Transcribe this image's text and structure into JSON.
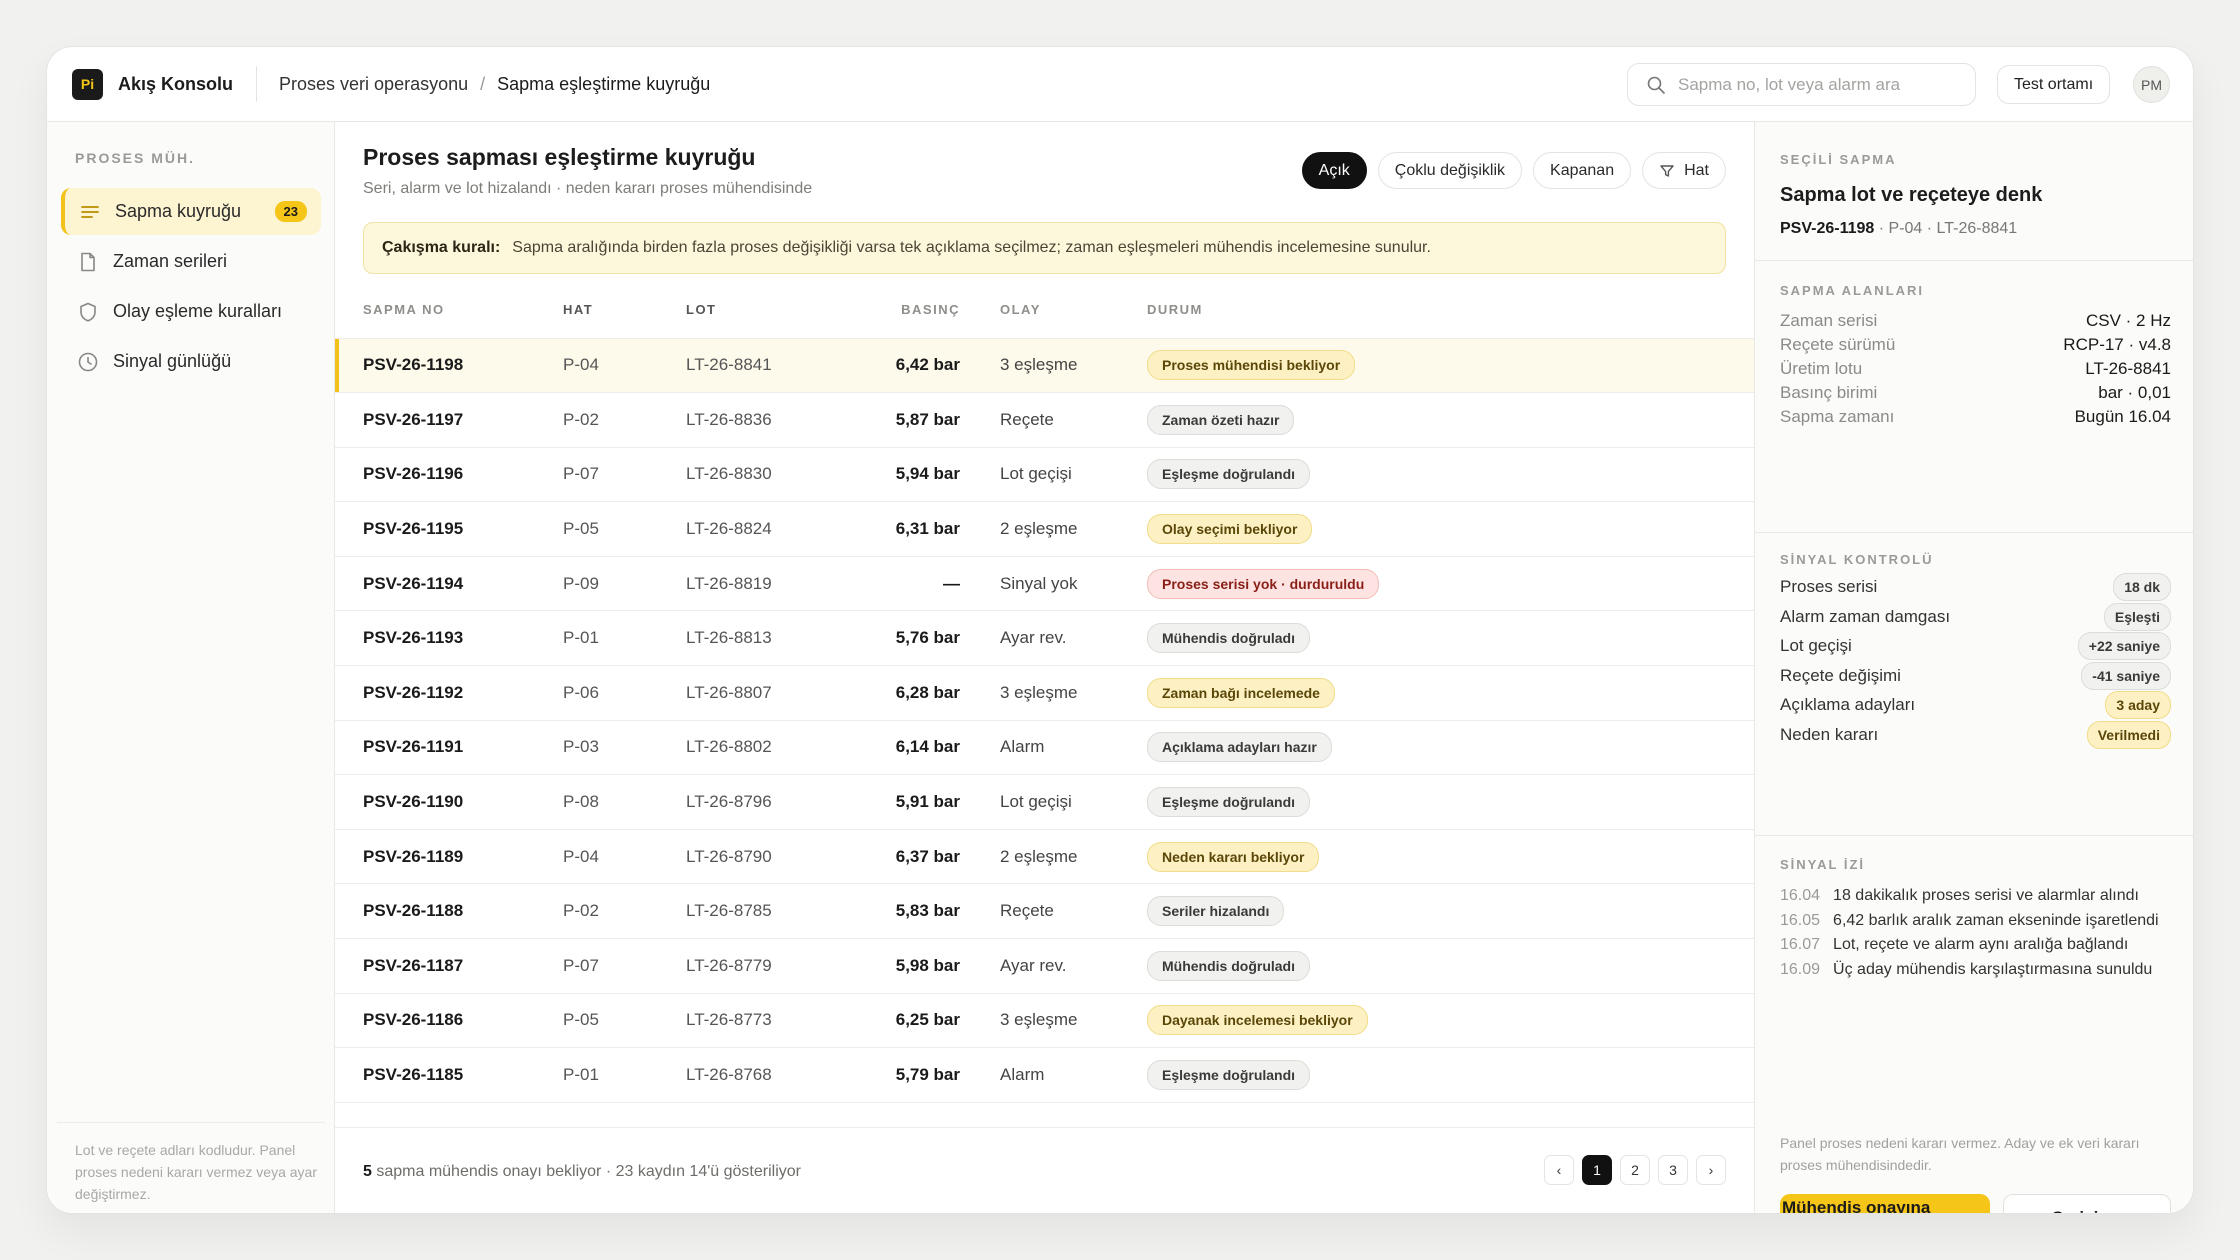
{
  "app": {
    "logo_text": "Pi",
    "name": "Akış Konsolu"
  },
  "breadcrumb": {
    "parent": "Proses veri operasyonu",
    "separator": "/",
    "current": "Sapma eşleştirme kuyruğu"
  },
  "search": {
    "placeholder": "Sapma no, lot veya alarm ara",
    "icon": "search-icon"
  },
  "env_button": "Test ortamı",
  "avatar": "PM",
  "sidebar": {
    "section": "PROSES MÜH.",
    "items": [
      {
        "label": "Sapma kuyruğu",
        "badge": "23",
        "icon": "list-icon",
        "active": true
      },
      {
        "label": "Zaman serileri",
        "icon": "document-icon"
      },
      {
        "label": "Olay eşleme kuralları",
        "icon": "shield-icon"
      },
      {
        "label": "Sinyal günlüğü",
        "icon": "clock-icon"
      }
    ],
    "footer": "Lot ve reçete adları kodludur. Panel proses nedeni kararı vermez veya ayar değiştirmez."
  },
  "main": {
    "title": "Proses sapması eşleştirme kuyruğu",
    "subtitle": "Seri, alarm ve lot hizalandı · neden kararı proses mühendisinde",
    "filters": [
      "Açık",
      "Çoklu değişiklik",
      "Kapanan",
      "Hat"
    ],
    "rule": {
      "label": "Çakışma kuralı:",
      "text": "Sapma aralığında birden fazla proses değişikliği varsa tek açıklama seçilmez; zaman eşleşmeleri mühendis incelemesine sunulur."
    },
    "columns": [
      "SAPMA NO",
      "HAT",
      "LOT",
      "BASINÇ",
      "OLAY",
      "DURUM"
    ],
    "rows": [
      {
        "no": "PSV-26-1198",
        "hat": "P-04",
        "lot": "LT-26-8841",
        "basinc": "6,42 bar",
        "olay": "3 eşleşme",
        "durum": "Proses mühendisi bekliyor",
        "tone": "yellow"
      },
      {
        "no": "PSV-26-1197",
        "hat": "P-02",
        "lot": "LT-26-8836",
        "basinc": "5,87 bar",
        "olay": "Reçete",
        "durum": "Zaman özeti hazır",
        "tone": "gray"
      },
      {
        "no": "PSV-26-1196",
        "hat": "P-07",
        "lot": "LT-26-8830",
        "basinc": "5,94 bar",
        "olay": "Lot geçişi",
        "durum": "Eşleşme doğrulandı",
        "tone": "gray"
      },
      {
        "no": "PSV-26-1195",
        "hat": "P-05",
        "lot": "LT-26-8824",
        "basinc": "6,31 bar",
        "olay": "2 eşleşme",
        "durum": "Olay seçimi bekliyor",
        "tone": "yellow"
      },
      {
        "no": "PSV-26-1194",
        "hat": "P-09",
        "lot": "LT-26-8819",
        "basinc": "—",
        "olay": "Sinyal yok",
        "durum": "Proses serisi yok · durduruldu",
        "tone": "red"
      },
      {
        "no": "PSV-26-1193",
        "hat": "P-01",
        "lot": "LT-26-8813",
        "basinc": "5,76 bar",
        "olay": "Ayar rev.",
        "durum": "Mühendis doğruladı",
        "tone": "gray"
      },
      {
        "no": "PSV-26-1192",
        "hat": "P-06",
        "lot": "LT-26-8807",
        "basinc": "6,28 bar",
        "olay": "3 eşleşme",
        "durum": "Zaman bağı incelemede",
        "tone": "yellow"
      },
      {
        "no": "PSV-26-1191",
        "hat": "P-03",
        "lot": "LT-26-8802",
        "basinc": "6,14 bar",
        "olay": "Alarm",
        "durum": "Açıklama adayları hazır",
        "tone": "gray"
      },
      {
        "no": "PSV-26-1190",
        "hat": "P-08",
        "lot": "LT-26-8796",
        "basinc": "5,91 bar",
        "olay": "Lot geçişi",
        "durum": "Eşleşme doğrulandı",
        "tone": "gray"
      },
      {
        "no": "PSV-26-1189",
        "hat": "P-04",
        "lot": "LT-26-8790",
        "basinc": "6,37 bar",
        "olay": "2 eşleşme",
        "durum": "Neden kararı bekliyor",
        "tone": "yellow"
      },
      {
        "no": "PSV-26-1188",
        "hat": "P-02",
        "lot": "LT-26-8785",
        "basinc": "5,83 bar",
        "olay": "Reçete",
        "durum": "Seriler hizalandı",
        "tone": "gray"
      },
      {
        "no": "PSV-26-1187",
        "hat": "P-07",
        "lot": "LT-26-8779",
        "basinc": "5,98 bar",
        "olay": "Ayar rev.",
        "durum": "Mühendis doğruladı",
        "tone": "gray"
      },
      {
        "no": "PSV-26-1186",
        "hat": "P-05",
        "lot": "LT-26-8773",
        "basinc": "6,25 bar",
        "olay": "3 eşleşme",
        "durum": "Dayanak incelemesi bekliyor",
        "tone": "yellow"
      },
      {
        "no": "PSV-26-1185",
        "hat": "P-01",
        "lot": "LT-26-8768",
        "basinc": "5,79 bar",
        "olay": "Alarm",
        "durum": "Eşleşme doğrulandı",
        "tone": "gray"
      }
    ],
    "footer": {
      "count": "5",
      "text": "sapma mühendis onayı bekliyor · 23 kaydın 14'ü gösteriliyor"
    },
    "pager": {
      "prev": "‹",
      "pages": [
        "1",
        "2",
        "3"
      ],
      "next": "›",
      "current": "1"
    }
  },
  "panel": {
    "section": "SEÇİLİ SAPMA",
    "title": "Sapma lot ve reçeteye denk",
    "id": "PSV-26-1198",
    "meta": "· P-04 · LT-26-8841",
    "fields_label": "SAPMA ALANLARI",
    "fields": [
      {
        "k": "Zaman serisi",
        "v": "CSV · 2 Hz"
      },
      {
        "k": "Reçete sürümü",
        "v": "RCP-17 · v4.8"
      },
      {
        "k": "Üretim lotu",
        "v": "LT-26-8841"
      },
      {
        "k": "Basınç birimi",
        "v": "bar · 0,01"
      },
      {
        "k": "Sapma zamanı",
        "v": "Bugün 16.04"
      }
    ],
    "checks_label": "SİNYAL KONTROLÜ",
    "checks": [
      {
        "k": "Proses serisi",
        "v": "18 dk",
        "tone": "gray"
      },
      {
        "k": "Alarm zaman damgası",
        "v": "Eşleşti",
        "tone": "gray"
      },
      {
        "k": "Lot geçişi",
        "v": "+22 saniye",
        "tone": "gray"
      },
      {
        "k": "Reçete değişimi",
        "v": "-41 saniye",
        "tone": "gray"
      },
      {
        "k": "Açıklama adayları",
        "v": "3 aday",
        "tone": "yellow"
      },
      {
        "k": "Neden kararı",
        "v": "Verilmedi",
        "tone": "yellow"
      }
    ],
    "trail_label": "SİNYAL İZİ",
    "trail": [
      {
        "t": "16.04",
        "text": "18 dakikalık proses serisi ve alarmlar alındı"
      },
      {
        "t": "16.05",
        "text": "6,42 barlık aralık zaman ekseninde işaretlendi"
      },
      {
        "t": "16.07",
        "text": "Lot, reçete ve alarm aynı aralığa bağlandı"
      },
      {
        "t": "16.09",
        "text": "Üç aday mühendis karşılaştırmasına sunuldu"
      }
    ],
    "note": "Panel proses nedeni kararı vermez. Aday ve ek veri kararı proses mühendisindedir.",
    "primary_button": "Mühendis onayına gönder",
    "secondary_button": "Seriyi aç"
  }
}
